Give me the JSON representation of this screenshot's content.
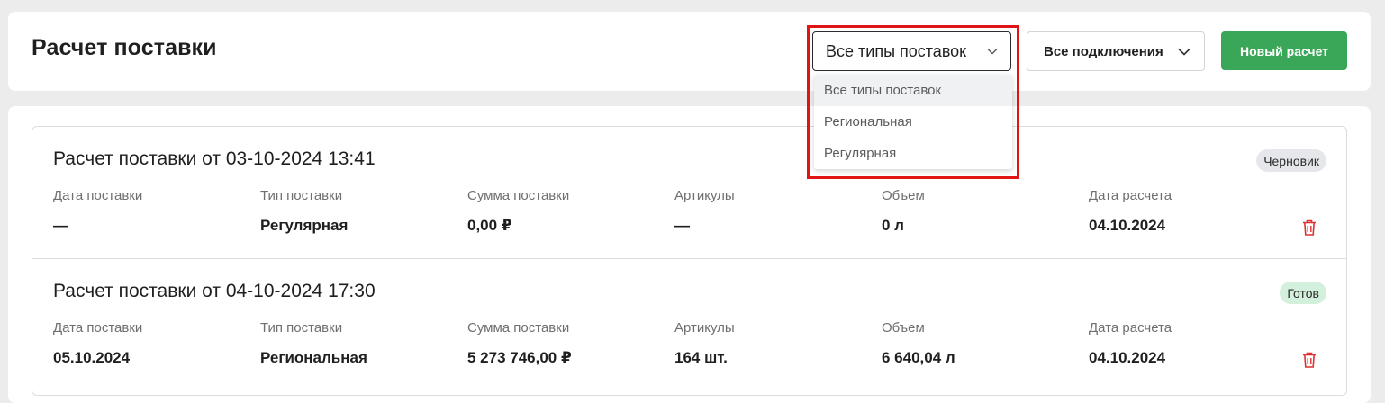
{
  "header": {
    "title": "Расчет поставки",
    "type_filter": {
      "selected": "Все типы поставок"
    },
    "connection_filter": {
      "selected": "Все подключения"
    },
    "new_button": "Новый расчет"
  },
  "dropdown": {
    "options": [
      "Все типы поставок",
      "Региональная",
      "Регулярная"
    ],
    "active_index": 0
  },
  "columns": [
    "Дата поставки",
    "Тип поставки",
    "Сумма поставки",
    "Артикулы",
    "Объем",
    "Дата расчета"
  ],
  "rows": [
    {
      "title": "Расчет поставки от 03-10-2024 13:41",
      "status": "Черновик",
      "values": [
        "—",
        "Регулярная",
        "0,00 ₽",
        "—",
        "0 л",
        "04.10.2024"
      ]
    },
    {
      "title": "Расчет поставки от 04-10-2024 17:30",
      "status": "Готов",
      "values": [
        "05.10.2024",
        "Региональная",
        "5 273 746,00 ₽",
        "164 шт.",
        "6 640,04 л",
        "04.10.2024"
      ]
    }
  ],
  "colors": {
    "accent_green": "#3aa657",
    "delete_red": "#e03131",
    "highlight_red": "#e01414"
  },
  "icons": [
    "chevron-down-icon",
    "trash-icon"
  ]
}
